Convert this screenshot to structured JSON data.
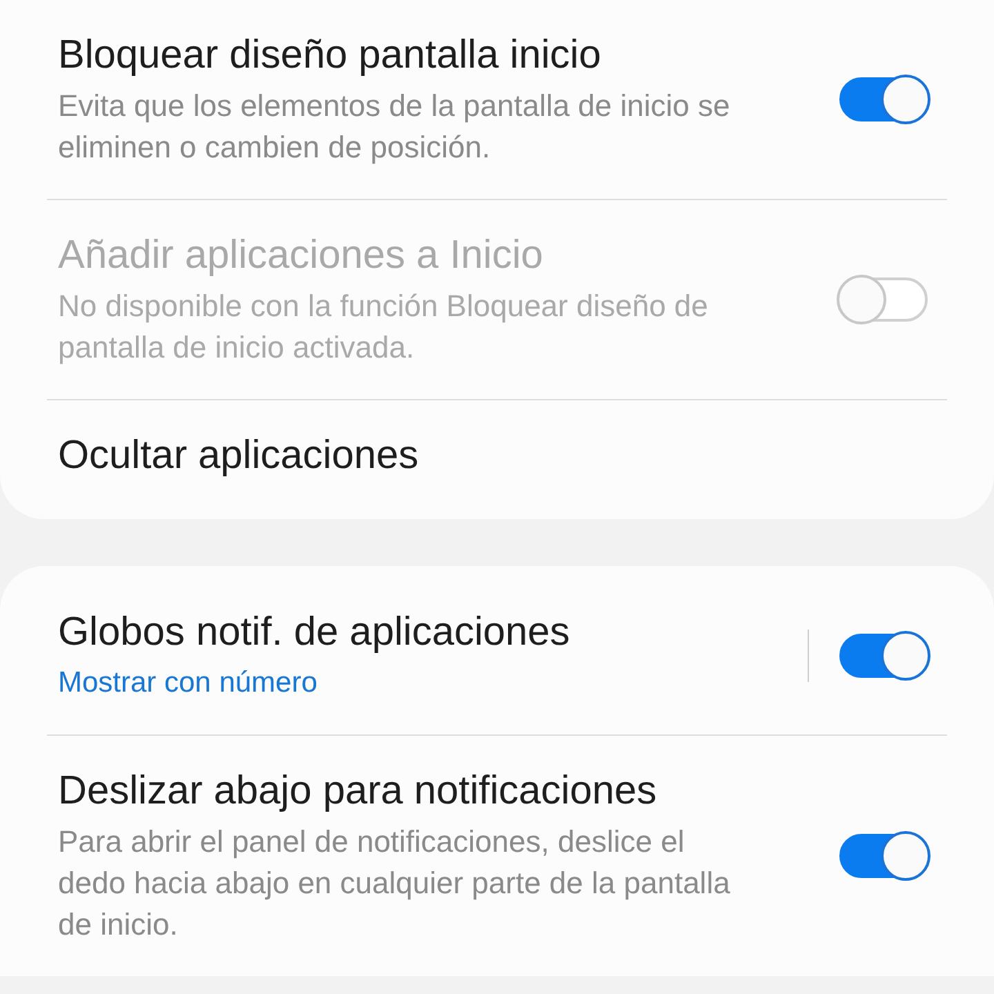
{
  "cards": [
    {
      "items": [
        {
          "kind": "toggle",
          "title": "Bloquear diseño pantalla inicio",
          "subtitle": "Evita que los elementos de la pantalla de inicio se eliminen o cambien de posición.",
          "on": true,
          "disabled": false
        },
        {
          "kind": "toggle",
          "title": "Añadir aplicaciones a Inicio",
          "subtitle": "No disponible con la función Bloquear diseño de pantalla de inicio activada.",
          "on": false,
          "disabled": true
        },
        {
          "kind": "link",
          "title": "Ocultar aplicaciones"
        }
      ]
    },
    {
      "items": [
        {
          "kind": "split-toggle",
          "title": "Globos notif. de aplicaciones",
          "value": "Mostrar con número",
          "on": true
        },
        {
          "kind": "toggle",
          "title": "Deslizar abajo para notificaciones",
          "subtitle": "Para abrir el panel de notificaciones, deslice el dedo hacia abajo en cualquier parte de la pantalla de inicio.",
          "on": true,
          "disabled": false
        }
      ]
    }
  ]
}
